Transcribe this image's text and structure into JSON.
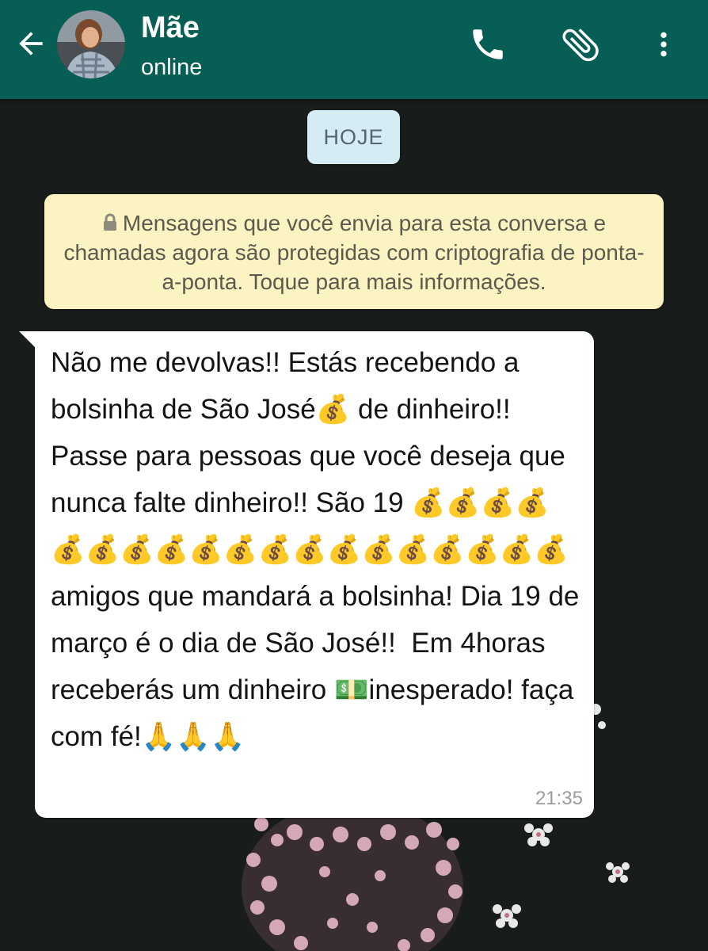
{
  "header": {
    "contact_name": "Mãe",
    "contact_status": "online",
    "colors": {
      "bar": "#075e54",
      "icon": "#ffffff"
    }
  },
  "chat": {
    "date_chip": "HOJE",
    "encryption_notice": "Mensagens que você envia para esta conversa e chamadas agora são protegidas com criptografia de ponta-a-ponta. Toque para mais informações.",
    "message": {
      "text": "Não me devolvas!! Estás recebendo a bolsinha de São José💰 de dinheiro!! Passe para pessoas que você deseja que nunca falte dinheiro!! São 19 💰💰💰💰💰💰💰💰💰💰💰💰💰💰💰💰💰💰💰 amigos que mandará a bolsinha! Dia 19 de março é o dia de São José!!  Em 4horas receberás um dinheiro 💵inesperado! faça com fé!🙏🙏🙏",
      "time": "21:35"
    }
  },
  "icons": {
    "back": "arrow-left-icon",
    "call": "phone-icon",
    "attach": "paperclip-icon",
    "menu": "more-vertical-icon",
    "lock": "lock-icon"
  }
}
